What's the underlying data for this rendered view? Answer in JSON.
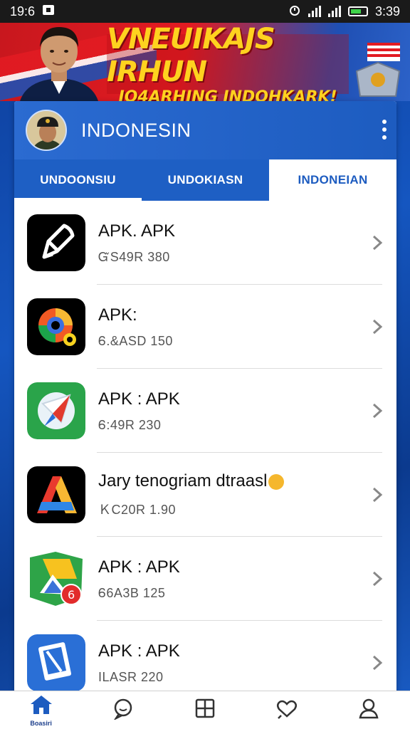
{
  "status_bar": {
    "time_left": "19:6",
    "time_right": "3:39"
  },
  "banner": {
    "line1": "VNEUIKAJS IRHUN",
    "line2": "IO4ARHING INDOHKARK!"
  },
  "header": {
    "title": "INDONESIN"
  },
  "tabs": [
    {
      "label": "UNDOONSIU"
    },
    {
      "label": "UNDOKIASN"
    },
    {
      "label": "INDONEIAN"
    }
  ],
  "apps": [
    {
      "title": "APK. APK",
      "subtitle": "ᏳS49R 380",
      "icon": "pencil-app-icon"
    },
    {
      "title": "APK:",
      "subtitle": "Ꮾ.&ASD 150",
      "icon": "colorful-gear-app-icon"
    },
    {
      "title": "APK : APK",
      "subtitle": "Ꮾ:49R 230",
      "icon": "compass-app-icon"
    },
    {
      "title": "Jary tenogriam dtraasl",
      "subtitle": "ＫC20R 1.90",
      "icon": "letter-a-app-icon"
    },
    {
      "title": "APK : APK",
      "subtitle": "Ꮾ6A3B 125",
      "icon": "drive-app-icon"
    },
    {
      "title": "APK : APK",
      "subtitle": "ILASR 220",
      "icon": "tablet-app-icon"
    }
  ],
  "nav": {
    "home_label": "Boasiri"
  },
  "colors": {
    "primary": "#1d5cc0",
    "banner_red": "#e21b22",
    "banner_yellow": "#ffd21f"
  }
}
